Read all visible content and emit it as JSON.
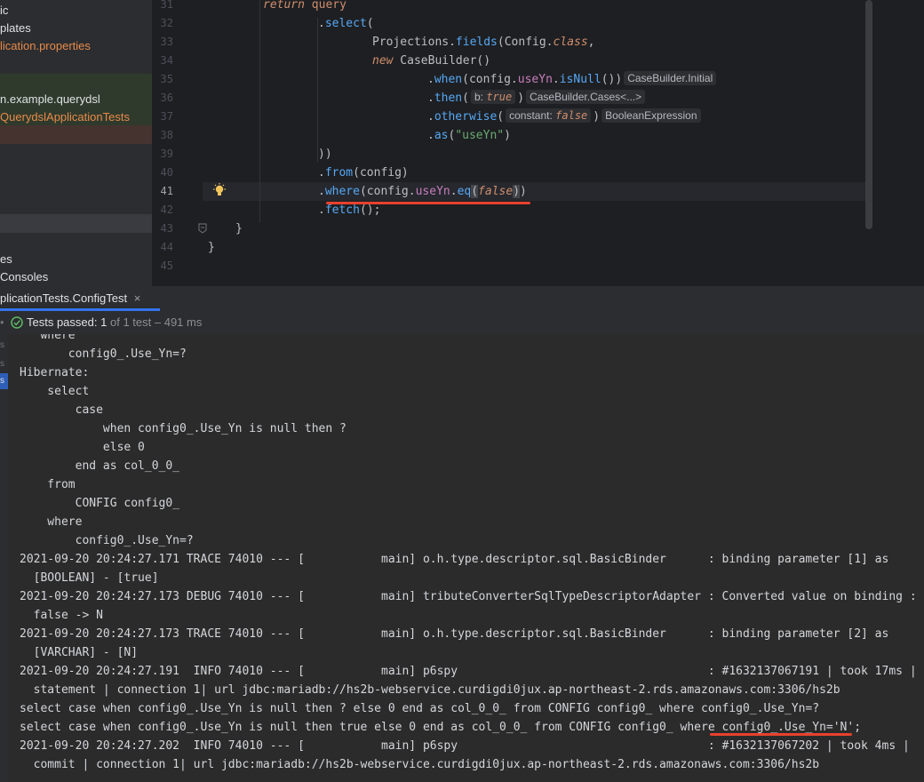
{
  "project_tree": {
    "items": [
      {
        "text": "ic",
        "color": "#dfe1e5"
      },
      {
        "text": "plates",
        "color": "#dfe1e5"
      },
      {
        "text": "lication.properties",
        "color": "#e88a4a"
      },
      {
        "text": "n.example.querydsl",
        "color": "#dfe1e5"
      },
      {
        "text": "QuerydslApplicationTests",
        "color": "#e88a4a"
      },
      {
        "text": "es",
        "color": "#dfe1e5"
      },
      {
        "text": "Consoles",
        "color": "#dfe1e5"
      }
    ]
  },
  "editor": {
    "line_numbers": [
      "31",
      "32",
      "33",
      "34",
      "35",
      "36",
      "37",
      "38",
      "39",
      "40",
      "41",
      "42",
      "43",
      "44",
      "45"
    ],
    "hints": {
      "initial": "CaseBuilder.Initial",
      "b_label": "b:",
      "b_value": "true",
      "cases": "CaseBuilder.Cases<...>",
      "constant_label": "constant:",
      "constant_value": "false",
      "boolexp": "BooleanExpression"
    }
  },
  "tool_window": {
    "tab_label": "plicationTests.ConfigTest",
    "tab_close": "×",
    "status": {
      "prefix": "Tests passed:",
      "count": "1",
      "of_total": "of 1 test",
      "dash": "–",
      "time": "491 ms"
    },
    "strip_label": "s"
  },
  "console": {
    "lines": [
      "   where",
      "       config0_.Use_Yn=?",
      "Hibernate: ",
      "    select",
      "        case ",
      "            when config0_.Use_Yn is null then ? ",
      "            else 0 ",
      "        end as col_0_0_ ",
      "    from",
      "        CONFIG config0_ ",
      "    where",
      "        config0_.Use_Yn=?",
      "2021-09-20 20:24:27.171 TRACE 74010 --- [           main] o.h.type.descriptor.sql.BasicBinder      : binding parameter [1] as",
      "  [BOOLEAN] - [true]",
      "2021-09-20 20:24:27.173 DEBUG 74010 --- [           main] tributeConverterSqlTypeDescriptorAdapter : Converted value on binding :",
      "  false -> N",
      "2021-09-20 20:24:27.173 TRACE 74010 --- [           main] o.h.type.descriptor.sql.BasicBinder      : binding parameter [2] as",
      "  [VARCHAR] - [N]",
      "2021-09-20 20:24:27.191  INFO 74010 --- [           main] p6spy                                    : #1632137067191 | took 17ms |",
      "  statement | connection 1| url jdbc:mariadb://hs2b-webservice.curdigdi0jux.ap-northeast-2.rds.amazonaws.com:3306/hs2b",
      "select case when config0_.Use_Yn is null then ? else 0 end as col_0_0_ from CONFIG config0_ where config0_.Use_Yn=?",
      "select case when config0_.Use_Yn is null then true else 0 end as col_0_0_ from CONFIG config0_ where config0_.Use_Yn='N';",
      "2021-09-20 20:24:27.202  INFO 74010 --- [           main] p6spy                                    : #1632137067202 | took 4ms |",
      "  commit | connection 1| url jdbc:mariadb://hs2b-webservice.curdigdi0jux.ap-northeast-2.rds.amazonaws.com:3306/hs2b"
    ]
  },
  "colors": {
    "accent": "#3574f0",
    "underline": "#e8412e",
    "success": "#5fb865"
  }
}
